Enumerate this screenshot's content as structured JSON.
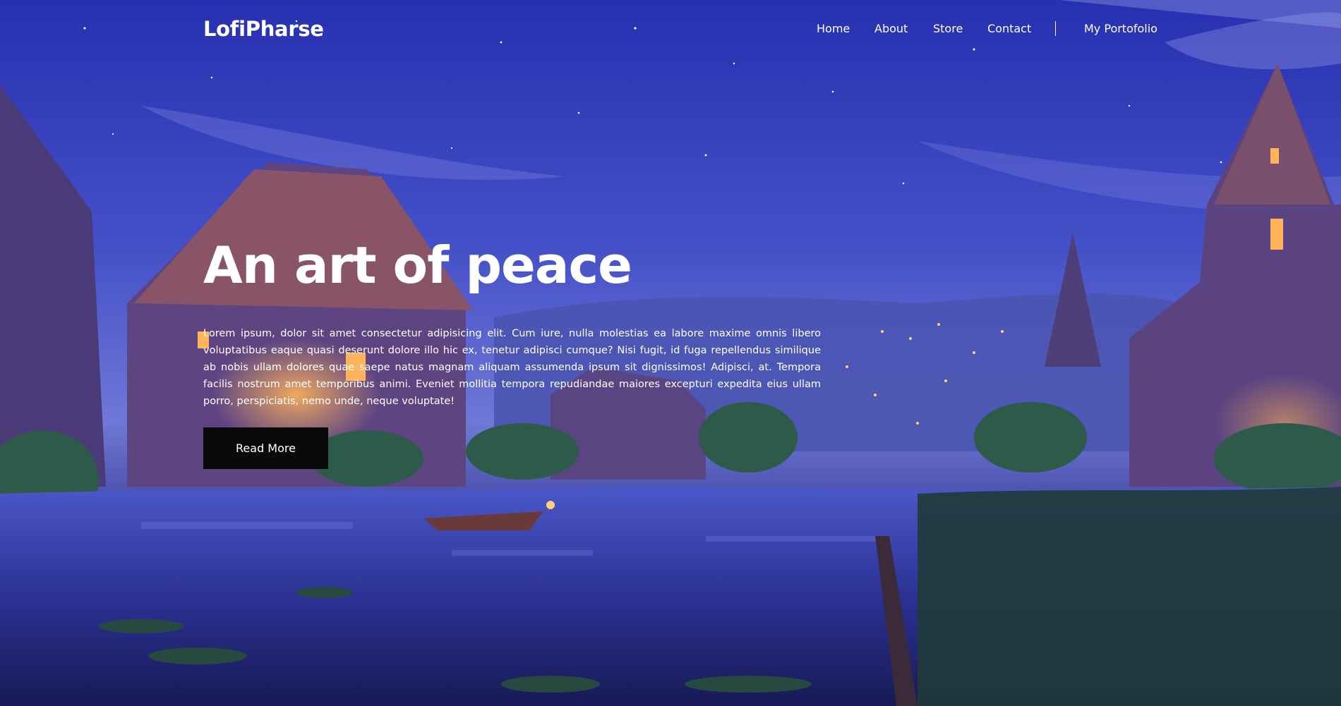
{
  "brand": "LofiPharse",
  "nav": {
    "items": [
      "Home",
      "About",
      "Store",
      "Contact"
    ],
    "portfolio": "My Portofolio"
  },
  "hero": {
    "title": "An art of peace",
    "body": "Lorem ipsum, dolor sit amet consectetur adipisicing elit. Cum iure, nulla molestias ea labore maxime omnis libero voluptatibus eaque quasi deserunt dolore illo hic ex, tenetur adipisci cumque? Nisi fugit, id fuga repellendus similique ab nobis ullam dolores quae saepe natus magnam aliquam assumenda ipsum sit dignissimos! Adipisci, at. Tempora facilis nostrum amet temporibus animi. Eveniet mollitia tempora repudiandae maiores excepturi expedita eius ullam porro, perspiciatis, nemo unde, neque voluptate!",
    "button": "Read More"
  },
  "colors": {
    "sky_top": "#2b33b6",
    "sky_mid": "#5a6ad8",
    "water": "#2a2f8a",
    "button_bg": "#0a0a0a"
  }
}
